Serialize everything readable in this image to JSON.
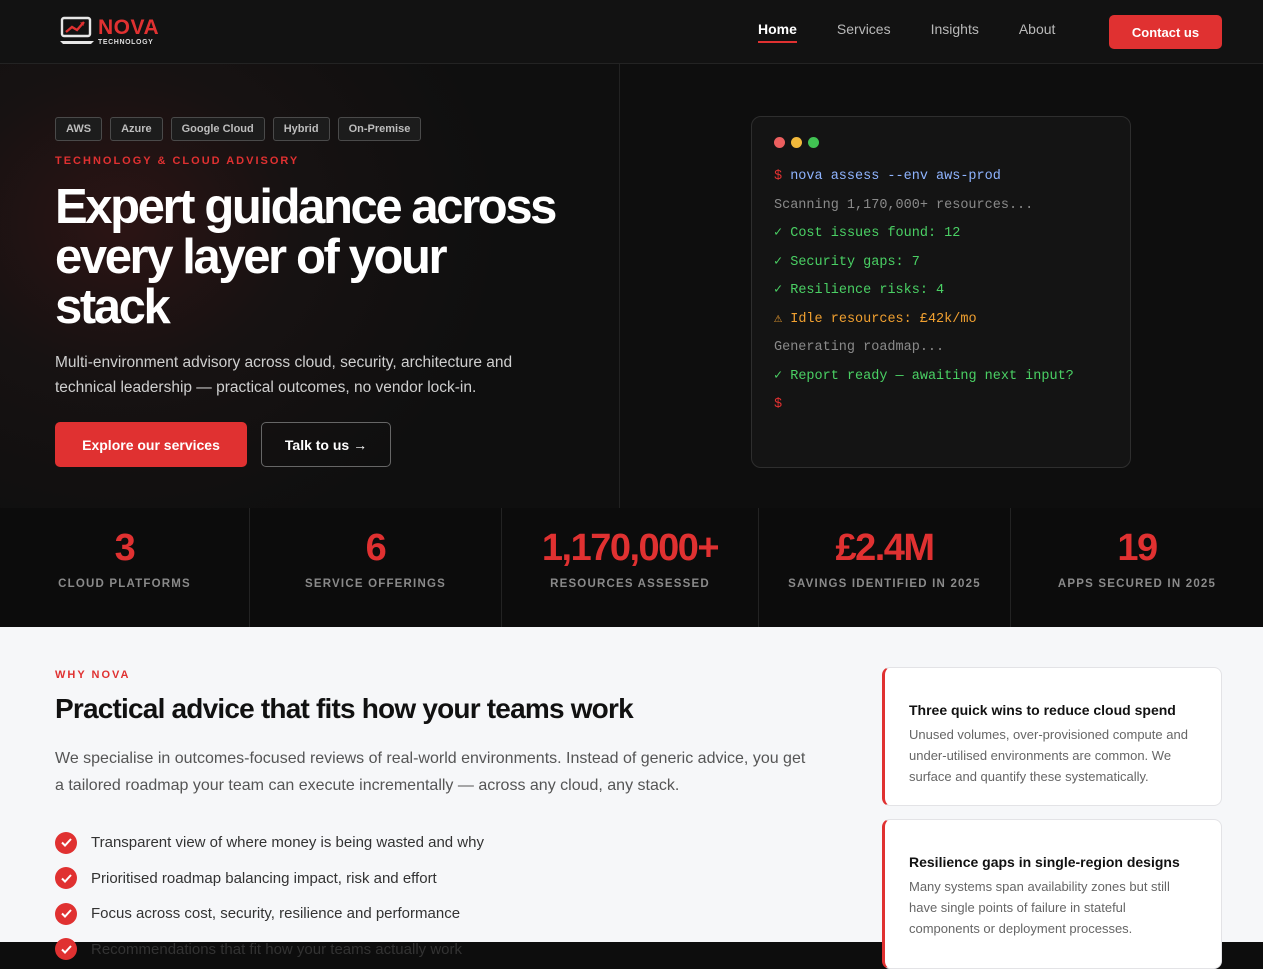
{
  "logo": {
    "brand": "NOVA",
    "tagline": "TECHNOLOGY"
  },
  "nav": {
    "links": [
      {
        "label": "Home",
        "active": true
      },
      {
        "label": "Services",
        "active": false
      },
      {
        "label": "Insights",
        "active": false
      },
      {
        "label": "About",
        "active": false
      }
    ],
    "contact_label": "Contact us"
  },
  "hero": {
    "tags": [
      "AWS",
      "Azure",
      "Google Cloud",
      "Hybrid",
      "On-Premise"
    ],
    "eyebrow": "TECHNOLOGY & CLOUD ADVISORY",
    "headline_line1": "Expert guidance across",
    "headline_line2": "every layer of your",
    "headline_line3": "stack",
    "subtext": "Multi-environment advisory across cloud, security, architecture and technical leadership — practical outcomes, no vendor lock-in.",
    "primary_button": "Explore our services",
    "secondary_button": "Talk to us →"
  },
  "terminal": {
    "lines": [
      {
        "prefix": "$ ",
        "text": "nova assess --env aws-prod",
        "style": "cmd"
      },
      {
        "prefix": "",
        "text": "Scanning 1,170,000+ resources...",
        "style": "dim"
      },
      {
        "prefix": "✓ ",
        "text": "Cost issues found: 12",
        "style": "ok"
      },
      {
        "prefix": "✓ ",
        "text": "Security gaps: 7",
        "style": "ok"
      },
      {
        "prefix": "✓ ",
        "text": "Resilience risks: 4",
        "style": "ok"
      },
      {
        "prefix": "⚠ ",
        "text": "Idle resources: £42k/mo",
        "style": "warn"
      },
      {
        "prefix": "",
        "text": "Generating roadmap...",
        "style": "dim"
      },
      {
        "prefix": "✓ ",
        "text": "Report ready — awaiting next input?",
        "style": "ok"
      },
      {
        "prefix": "$",
        "text": "",
        "style": "cmd"
      }
    ],
    "dot_colors": [
      "#ec5f5f",
      "#f2b93b",
      "#41c353"
    ]
  },
  "stats": [
    {
      "value": "3",
      "label": "CLOUD PLATFORMS"
    },
    {
      "value": "6",
      "label": "SERVICE OFFERINGS"
    },
    {
      "value": "1,170,000+",
      "label": "RESOURCES ASSESSED"
    },
    {
      "value": "£2.4M",
      "label": "SAVINGS IDENTIFIED IN 2025"
    },
    {
      "value": "19",
      "label": "APPS SECURED IN 2025"
    }
  ],
  "why": {
    "eyebrow": "WHY NOVA",
    "title": "Practical advice that fits how your teams work",
    "body": "We specialise in outcomes-focused reviews of real-world environments. Instead of generic advice, you get a tailored roadmap your team can execute incrementally — across any cloud, any stack.",
    "checks": [
      "Transparent view of where money is being wasted and why",
      "Prioritised roadmap balancing impact, risk and effort",
      "Focus across cost, security, resilience and performance",
      "Recommendations that fit how your teams actually work"
    ]
  },
  "cards": [
    {
      "title": "Three quick wins to reduce cloud spend",
      "body": "Unused volumes, over-provisioned compute and under-utilised environments are common. We surface and quantify these systematically."
    },
    {
      "title": "Resilience gaps in single-region designs",
      "body": "Many systems span availability zones but still have single points of failure in stateful components or deployment processes."
    }
  ],
  "colors": {
    "accent": "#e03131",
    "terminal_ok": "#4ad064",
    "terminal_warn": "#f0a030",
    "terminal_cmd": "#8fb4ff"
  }
}
